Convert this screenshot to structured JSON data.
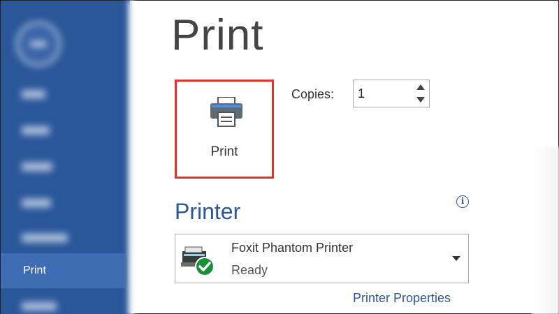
{
  "page": {
    "title": "Print"
  },
  "sidebar": {
    "active_item": "Print"
  },
  "print_button": {
    "label": "Print"
  },
  "copies": {
    "label": "Copies:",
    "value": "1"
  },
  "printer_section": {
    "title": "Printer",
    "info_glyph": "i",
    "selected_printer": {
      "name": "Foxit Phantom Printer",
      "status": "Ready"
    },
    "properties_link": "Printer Properties"
  },
  "icons": {
    "print": "printer-icon",
    "device": "printer-ready-icon",
    "info": "info-icon",
    "dropdown": "chevron-down-icon"
  },
  "colors": {
    "sidebar_bg": "#2b579a",
    "active_item_bg": "#3e6db4",
    "accent": "#2b579a",
    "highlight_border": "#e0312f",
    "ready_badge": "#1a8f3a"
  }
}
